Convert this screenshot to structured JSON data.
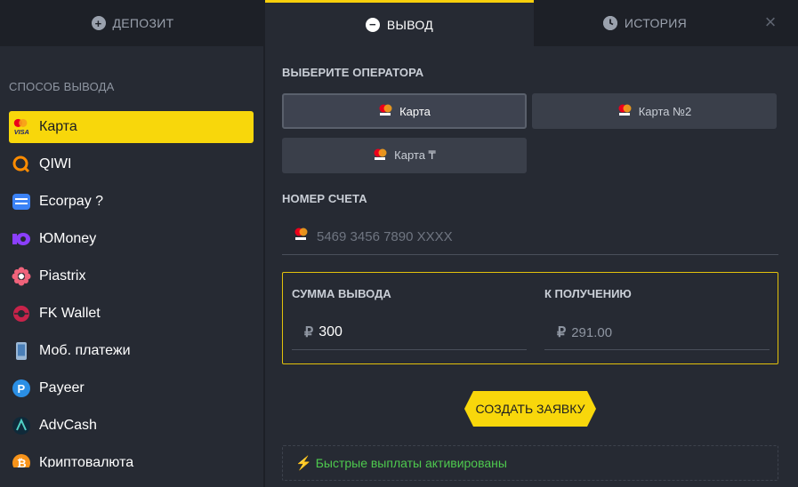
{
  "tabs": {
    "deposit": "ДЕПОЗИТ",
    "withdraw": "ВЫВОД",
    "history": "ИСТОРИЯ"
  },
  "close_icon": "×",
  "sidebar": {
    "title": "СПОСОБ ВЫВОДА",
    "items": [
      {
        "label": "Карта",
        "icon": "visa-mastercard-icon"
      },
      {
        "label": "QIWI",
        "icon": "qiwi-icon"
      },
      {
        "label": "Ecorpay ?",
        "icon": "ecorpay-icon"
      },
      {
        "label": "ЮMoney",
        "icon": "yoomoney-icon"
      },
      {
        "label": "Piastrix",
        "icon": "piastrix-icon"
      },
      {
        "label": "FK Wallet",
        "icon": "fk-wallet-icon"
      },
      {
        "label": "Моб. платежи",
        "icon": "mobile-phone-icon"
      },
      {
        "label": "Payeer",
        "icon": "payeer-icon"
      },
      {
        "label": "AdvCash",
        "icon": "advcash-icon"
      },
      {
        "label": "Криптовалюта",
        "icon": "bitcoin-icon"
      }
    ]
  },
  "operator": {
    "label": "ВЫБЕРИТЕ ОПЕРАТОРА",
    "options": [
      "Карта",
      "Карта №2",
      "Карта ₸"
    ]
  },
  "account": {
    "label": "НОМЕР СЧЕТА",
    "placeholder": "5469 3456 7890 XXXX"
  },
  "amount": {
    "label": "СУММА ВЫВОДА",
    "currency": "₽",
    "value": "300"
  },
  "receive": {
    "label": "К ПОЛУЧЕНИЮ",
    "currency": "₽",
    "value": "291.00"
  },
  "submit_label": "СОЗДАТЬ ЗАЯВКУ",
  "notice": "Быстрые выплаты активированы",
  "colors": {
    "accent": "#f8d70b",
    "background": "#262a33",
    "header": "#1d2027",
    "success": "#4ec94e"
  }
}
